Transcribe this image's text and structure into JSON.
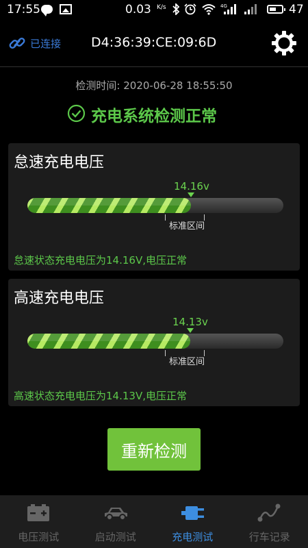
{
  "status_bar": {
    "time": "17:55",
    "net_speed": "0.03",
    "net_unit": "K/s",
    "network": "4G",
    "battery": "47"
  },
  "header": {
    "connection_status": "已连接",
    "device_mac": "D4:36:39:CE:09:6D"
  },
  "detect_time": "检测时间: 2020-06-28 18:55:50",
  "status_message": "充电系统检测正常",
  "cards": [
    {
      "title": "怠速充电电压",
      "value_label": "14.16v",
      "level_fraction": 0.64,
      "range_label": "标准区间",
      "message": "怠速状态充电电压为14.16V,电压正常"
    },
    {
      "title": "高速充电电压",
      "value_label": "14.13v",
      "level_fraction": 0.637,
      "range_label": "标准区间",
      "message": "高速状态充电电压为14.13V,电压正常"
    }
  ],
  "retest_button": "重新检测",
  "nav": [
    {
      "label": "电压测试",
      "icon": "battery-icon",
      "active": false
    },
    {
      "label": "启动测试",
      "icon": "car-icon",
      "active": false
    },
    {
      "label": "充电测试",
      "icon": "plug-icon",
      "active": true
    },
    {
      "label": "行车记录",
      "icon": "route-icon",
      "active": false
    }
  ],
  "colors": {
    "accent_green": "#5cc84a",
    "accent_blue": "#3d8ee0",
    "button_green": "#71c23b"
  }
}
